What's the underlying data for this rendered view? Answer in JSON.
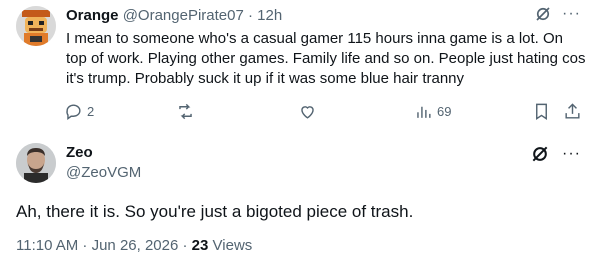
{
  "reply": {
    "name": "Orange",
    "handle": "@OrangePirate07",
    "separator": "·",
    "time": "12h",
    "text": "I mean to someone who's a casual gamer 115 hours inna game is a lot. On top of work. Playing other games. Family life and so on. People just hating cos it's trump. Probably suck it up if it was some blue hair tranny",
    "more": "···",
    "actions": {
      "replies": "2",
      "reposts": "",
      "likes": "",
      "views": "69"
    }
  },
  "tweet": {
    "name": "Zeo",
    "handle": "@ZeoVGM",
    "more": "···",
    "text": "Ah, there it is. So you're just a bigoted piece of trash.",
    "timestamp": "11:10 AM · Jun 26, 2026 ·",
    "views_count": "23",
    "views_label": "Views"
  },
  "colors": {
    "text_primary": "#0f1419",
    "text_secondary": "#536471"
  },
  "icons": {
    "grok": "grok-icon",
    "more": "more-icon",
    "reply": "reply-icon",
    "repost": "repost-icon",
    "like": "like-icon",
    "views": "views-icon",
    "bookmark": "bookmark-icon",
    "share": "share-icon"
  }
}
